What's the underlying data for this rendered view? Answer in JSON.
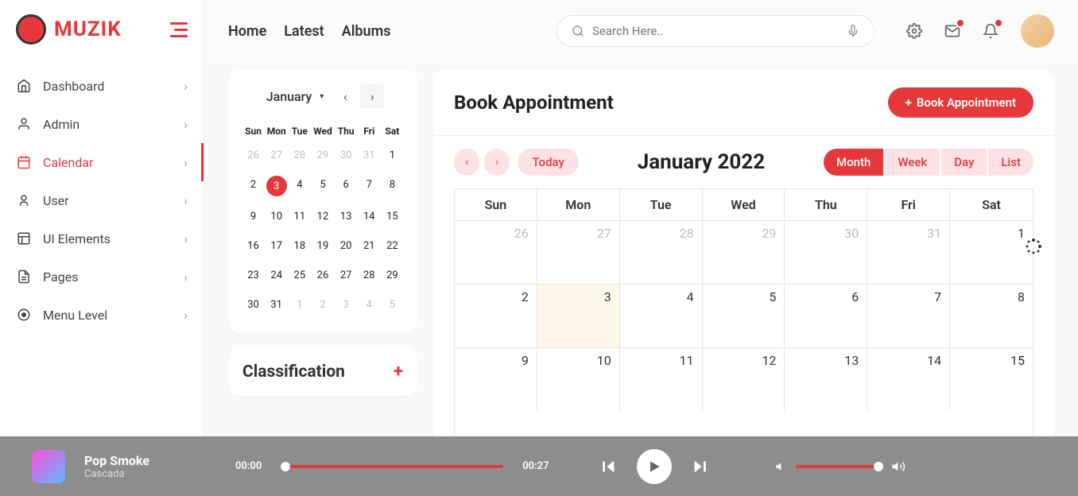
{
  "brand": "MUZIK",
  "nav": [
    {
      "label": "Dashboard",
      "icon": "home"
    },
    {
      "label": "Admin",
      "icon": "user"
    },
    {
      "label": "Calendar",
      "icon": "calendar",
      "active": true
    },
    {
      "label": "User",
      "icon": "user2"
    },
    {
      "label": "UI Elements",
      "icon": "grid"
    },
    {
      "label": "Pages",
      "icon": "file"
    },
    {
      "label": "Menu Level",
      "icon": "dot"
    }
  ],
  "topnav": [
    "Home",
    "Latest",
    "Albums"
  ],
  "search": {
    "placeholder": "Search Here.."
  },
  "miniCal": {
    "month": "January",
    "dow": [
      "Sun",
      "Mon",
      "Tue",
      "Wed",
      "Thu",
      "Fri",
      "Sat"
    ],
    "days": [
      {
        "d": "26",
        "out": true
      },
      {
        "d": "27",
        "out": true
      },
      {
        "d": "28",
        "out": true
      },
      {
        "d": "29",
        "out": true
      },
      {
        "d": "30",
        "out": true
      },
      {
        "d": "31",
        "out": true
      },
      {
        "d": "1"
      },
      {
        "d": "2"
      },
      {
        "d": "3",
        "today": true
      },
      {
        "d": "4"
      },
      {
        "d": "5"
      },
      {
        "d": "6"
      },
      {
        "d": "7"
      },
      {
        "d": "8"
      },
      {
        "d": "9"
      },
      {
        "d": "10"
      },
      {
        "d": "11"
      },
      {
        "d": "12"
      },
      {
        "d": "13"
      },
      {
        "d": "14"
      },
      {
        "d": "15"
      },
      {
        "d": "16"
      },
      {
        "d": "17"
      },
      {
        "d": "18"
      },
      {
        "d": "19"
      },
      {
        "d": "20"
      },
      {
        "d": "21"
      },
      {
        "d": "22"
      },
      {
        "d": "23"
      },
      {
        "d": "24"
      },
      {
        "d": "25"
      },
      {
        "d": "26"
      },
      {
        "d": "27"
      },
      {
        "d": "28"
      },
      {
        "d": "29"
      },
      {
        "d": "30"
      },
      {
        "d": "31"
      },
      {
        "d": "1",
        "out": true
      },
      {
        "d": "2",
        "out": true
      },
      {
        "d": "3",
        "out": true
      },
      {
        "d": "4",
        "out": true
      },
      {
        "d": "5",
        "out": true
      }
    ]
  },
  "classification": {
    "title": "Classification"
  },
  "book": {
    "title": "Book Appointment",
    "btn": "Book Appointment",
    "today": "Today",
    "calTitle": "January 2022",
    "views": [
      "Month",
      "Week",
      "Day",
      "List"
    ],
    "dow": [
      "Sun",
      "Mon",
      "Tue",
      "Wed",
      "Thu",
      "Fri",
      "Sat"
    ],
    "cells": [
      {
        "d": "26",
        "out": true
      },
      {
        "d": "27",
        "out": true
      },
      {
        "d": "28",
        "out": true
      },
      {
        "d": "29",
        "out": true
      },
      {
        "d": "30",
        "out": true
      },
      {
        "d": "31",
        "out": true
      },
      {
        "d": "1"
      },
      {
        "d": "2"
      },
      {
        "d": "3",
        "hl": true
      },
      {
        "d": "4"
      },
      {
        "d": "5"
      },
      {
        "d": "6"
      },
      {
        "d": "7"
      },
      {
        "d": "8"
      },
      {
        "d": "9"
      },
      {
        "d": "10"
      },
      {
        "d": "11"
      },
      {
        "d": "12"
      },
      {
        "d": "13"
      },
      {
        "d": "14"
      },
      {
        "d": "15"
      }
    ]
  },
  "player": {
    "title": "Pop Smoke",
    "artist": "Cascada",
    "current": "00:00",
    "duration": "00:27"
  }
}
